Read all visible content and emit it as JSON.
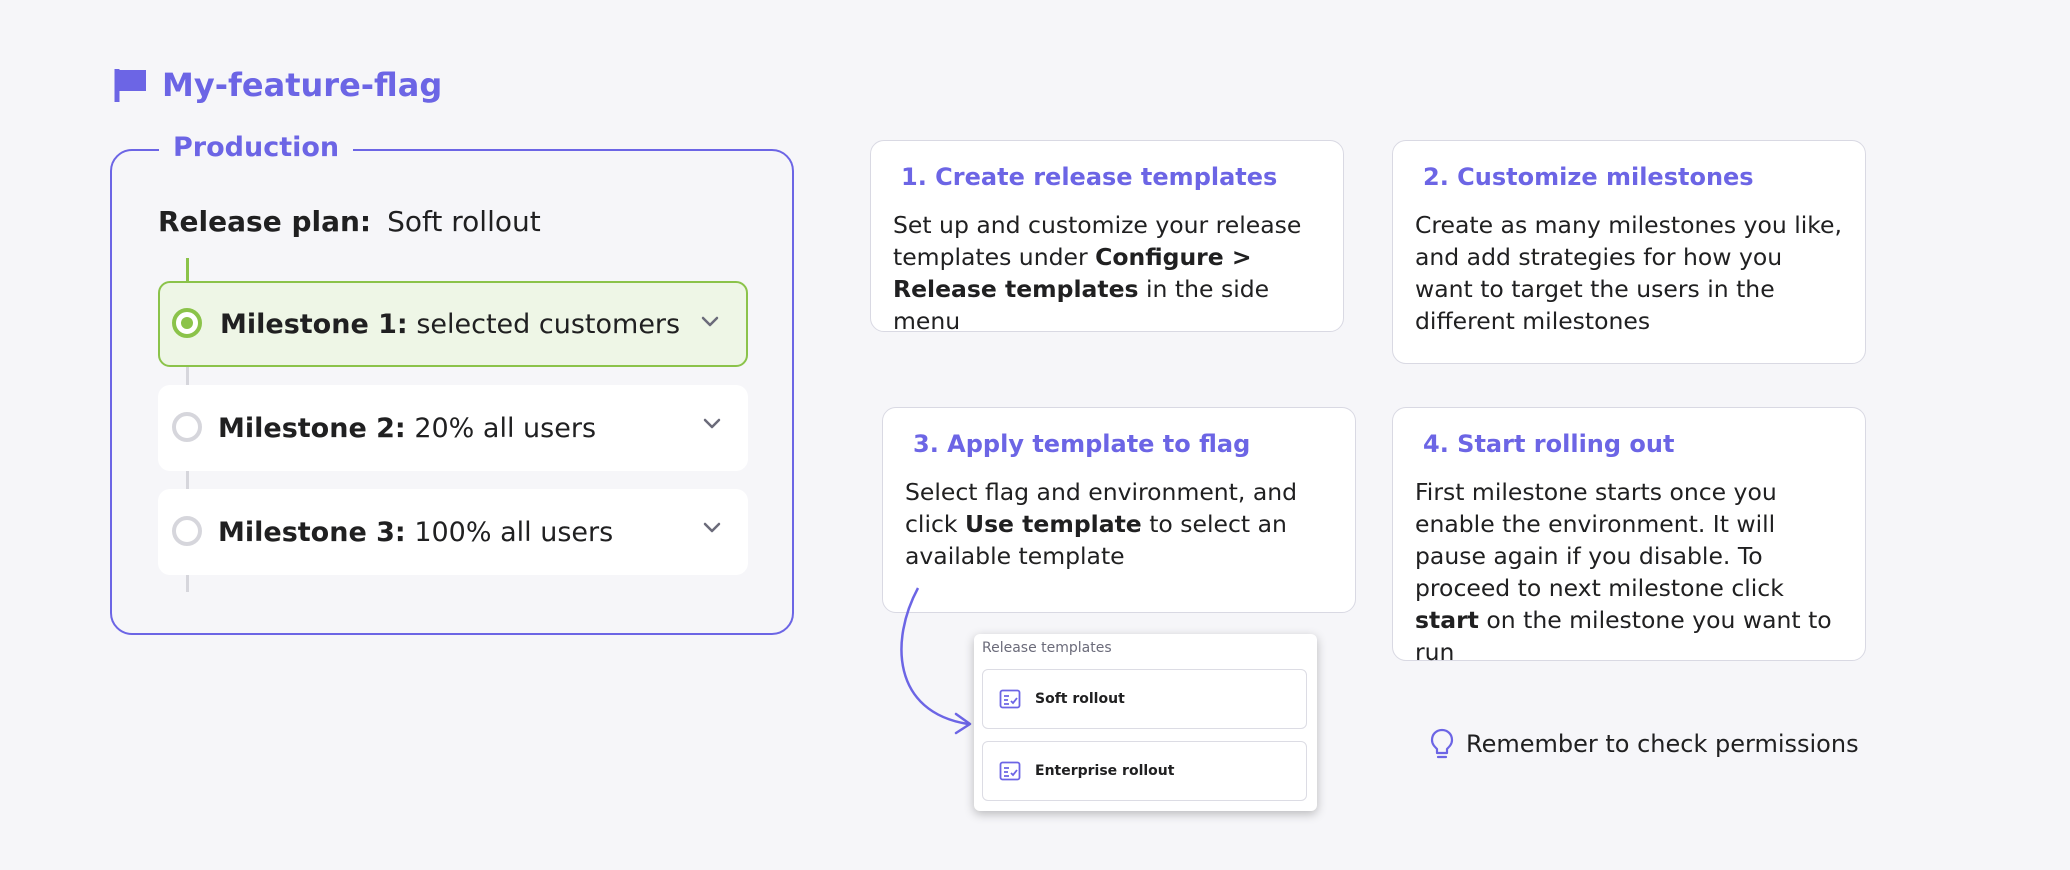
{
  "flag": {
    "name": "My-feature-flag",
    "icon": "flag-icon"
  },
  "environment": {
    "label": "Production",
    "release_plan_label": "Release plan:",
    "release_plan_value": "Soft rollout"
  },
  "milestones": [
    {
      "label": "Milestone 1:",
      "value": "selected customers",
      "state": "active"
    },
    {
      "label": "Milestone 2:",
      "value": "20% all users",
      "state": "inactive"
    },
    {
      "label": "Milestone 3:",
      "value": "100% all users",
      "state": "inactive"
    }
  ],
  "steps": [
    {
      "title": "1. Create release templates",
      "body_parts": [
        "Set up and customize your release templates under ",
        "Configure > Release templates",
        " in the side menu"
      ]
    },
    {
      "title": "2. Customize milestones",
      "body": "Create as many milestones you like, and add strategies for how you want to target the users in the different milestones"
    },
    {
      "title": "3. Apply template to flag",
      "body_parts": [
        "Select flag and environment, and click ",
        "Use template",
        " to select an available template"
      ]
    },
    {
      "title": "4. Start rolling out",
      "body_parts": [
        "First milestone starts once you enable the environment. It will pause again if you disable. To proceed to next milestone click ",
        "start",
        " on the milestone you want to run"
      ]
    }
  ],
  "templates_popup": {
    "title": "Release templates",
    "items": [
      "Soft rollout",
      "Enterprise rollout"
    ]
  },
  "reminder": {
    "icon": "lightbulb-icon",
    "text": "Remember to check permissions"
  },
  "colors": {
    "accent": "#6c65e5",
    "active_green": "#8bc34a",
    "active_bg": "#eef6e6",
    "background": "#f6f6f9"
  }
}
